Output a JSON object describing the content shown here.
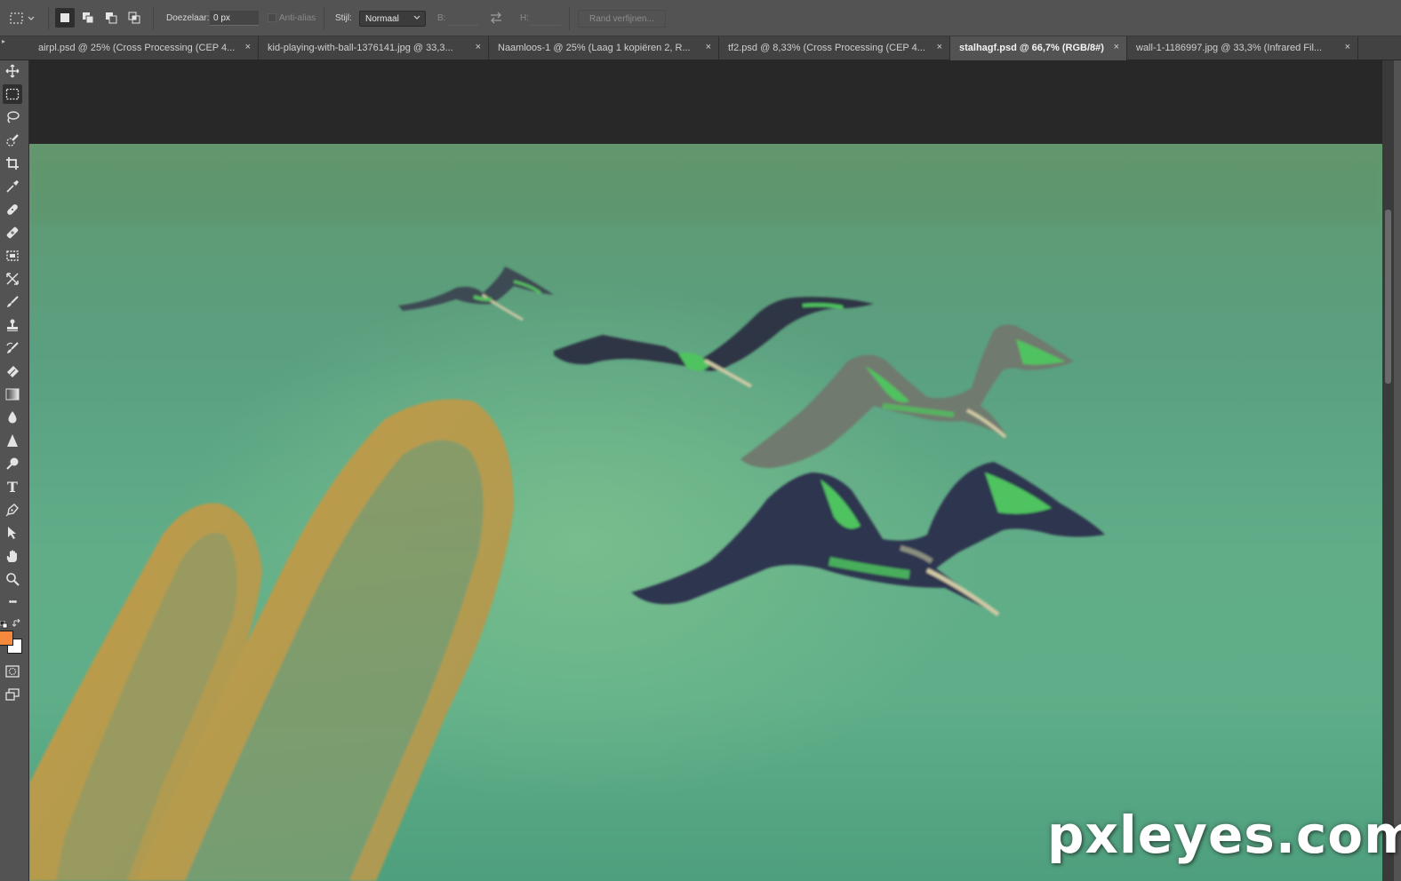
{
  "options_bar": {
    "feather_label": "Doezelaar:",
    "feather_value": "0 px",
    "antialias_label": "Anti-alias",
    "style_label": "Stijl:",
    "style_value": "Normaal",
    "width_label": "B:",
    "height_label": "H:",
    "refine_edge_label": "Rand verfijnen..."
  },
  "tabs": [
    {
      "label": "airpl.psd @ 25% (Cross Processing (CEP 4...",
      "close": "×",
      "active": false
    },
    {
      "label": "kid-playing-with-ball-1376141.jpg @ 33,3...",
      "close": "×",
      "active": false
    },
    {
      "label": "Naamloos-1 @ 25% (Laag 1 kopiëren 2, R...",
      "close": "×",
      "active": false
    },
    {
      "label": "tf2.psd @ 8,33% (Cross Processing (CEP 4...",
      "close": "×",
      "active": false
    },
    {
      "label": "stalhagf.psd @ 66,7% (RGB/8#)",
      "close": "×",
      "active": true
    },
    {
      "label": "wall-1-1186997.jpg @ 33,3% (Infrared Fil...",
      "close": "×",
      "active": false
    }
  ],
  "toolbar": {
    "type_tool_glyph": "T",
    "more_tools_glyph": "•••",
    "foreground_color": "#f58a3c",
    "background_color": "#ffffff",
    "active_tool": "rectangular-marquee"
  },
  "colors": {
    "panel_bg": "#535353",
    "tab_bar_bg": "#424242",
    "canvas_bg": "#282828",
    "art_sky": "#5fae89",
    "art_beak_ochre": "#c9a04c",
    "bird_dark": "#2f3550",
    "bird_grey": "#6f7a6e",
    "bird_green": "#4fc35e"
  },
  "watermark": "pxleyes.com"
}
